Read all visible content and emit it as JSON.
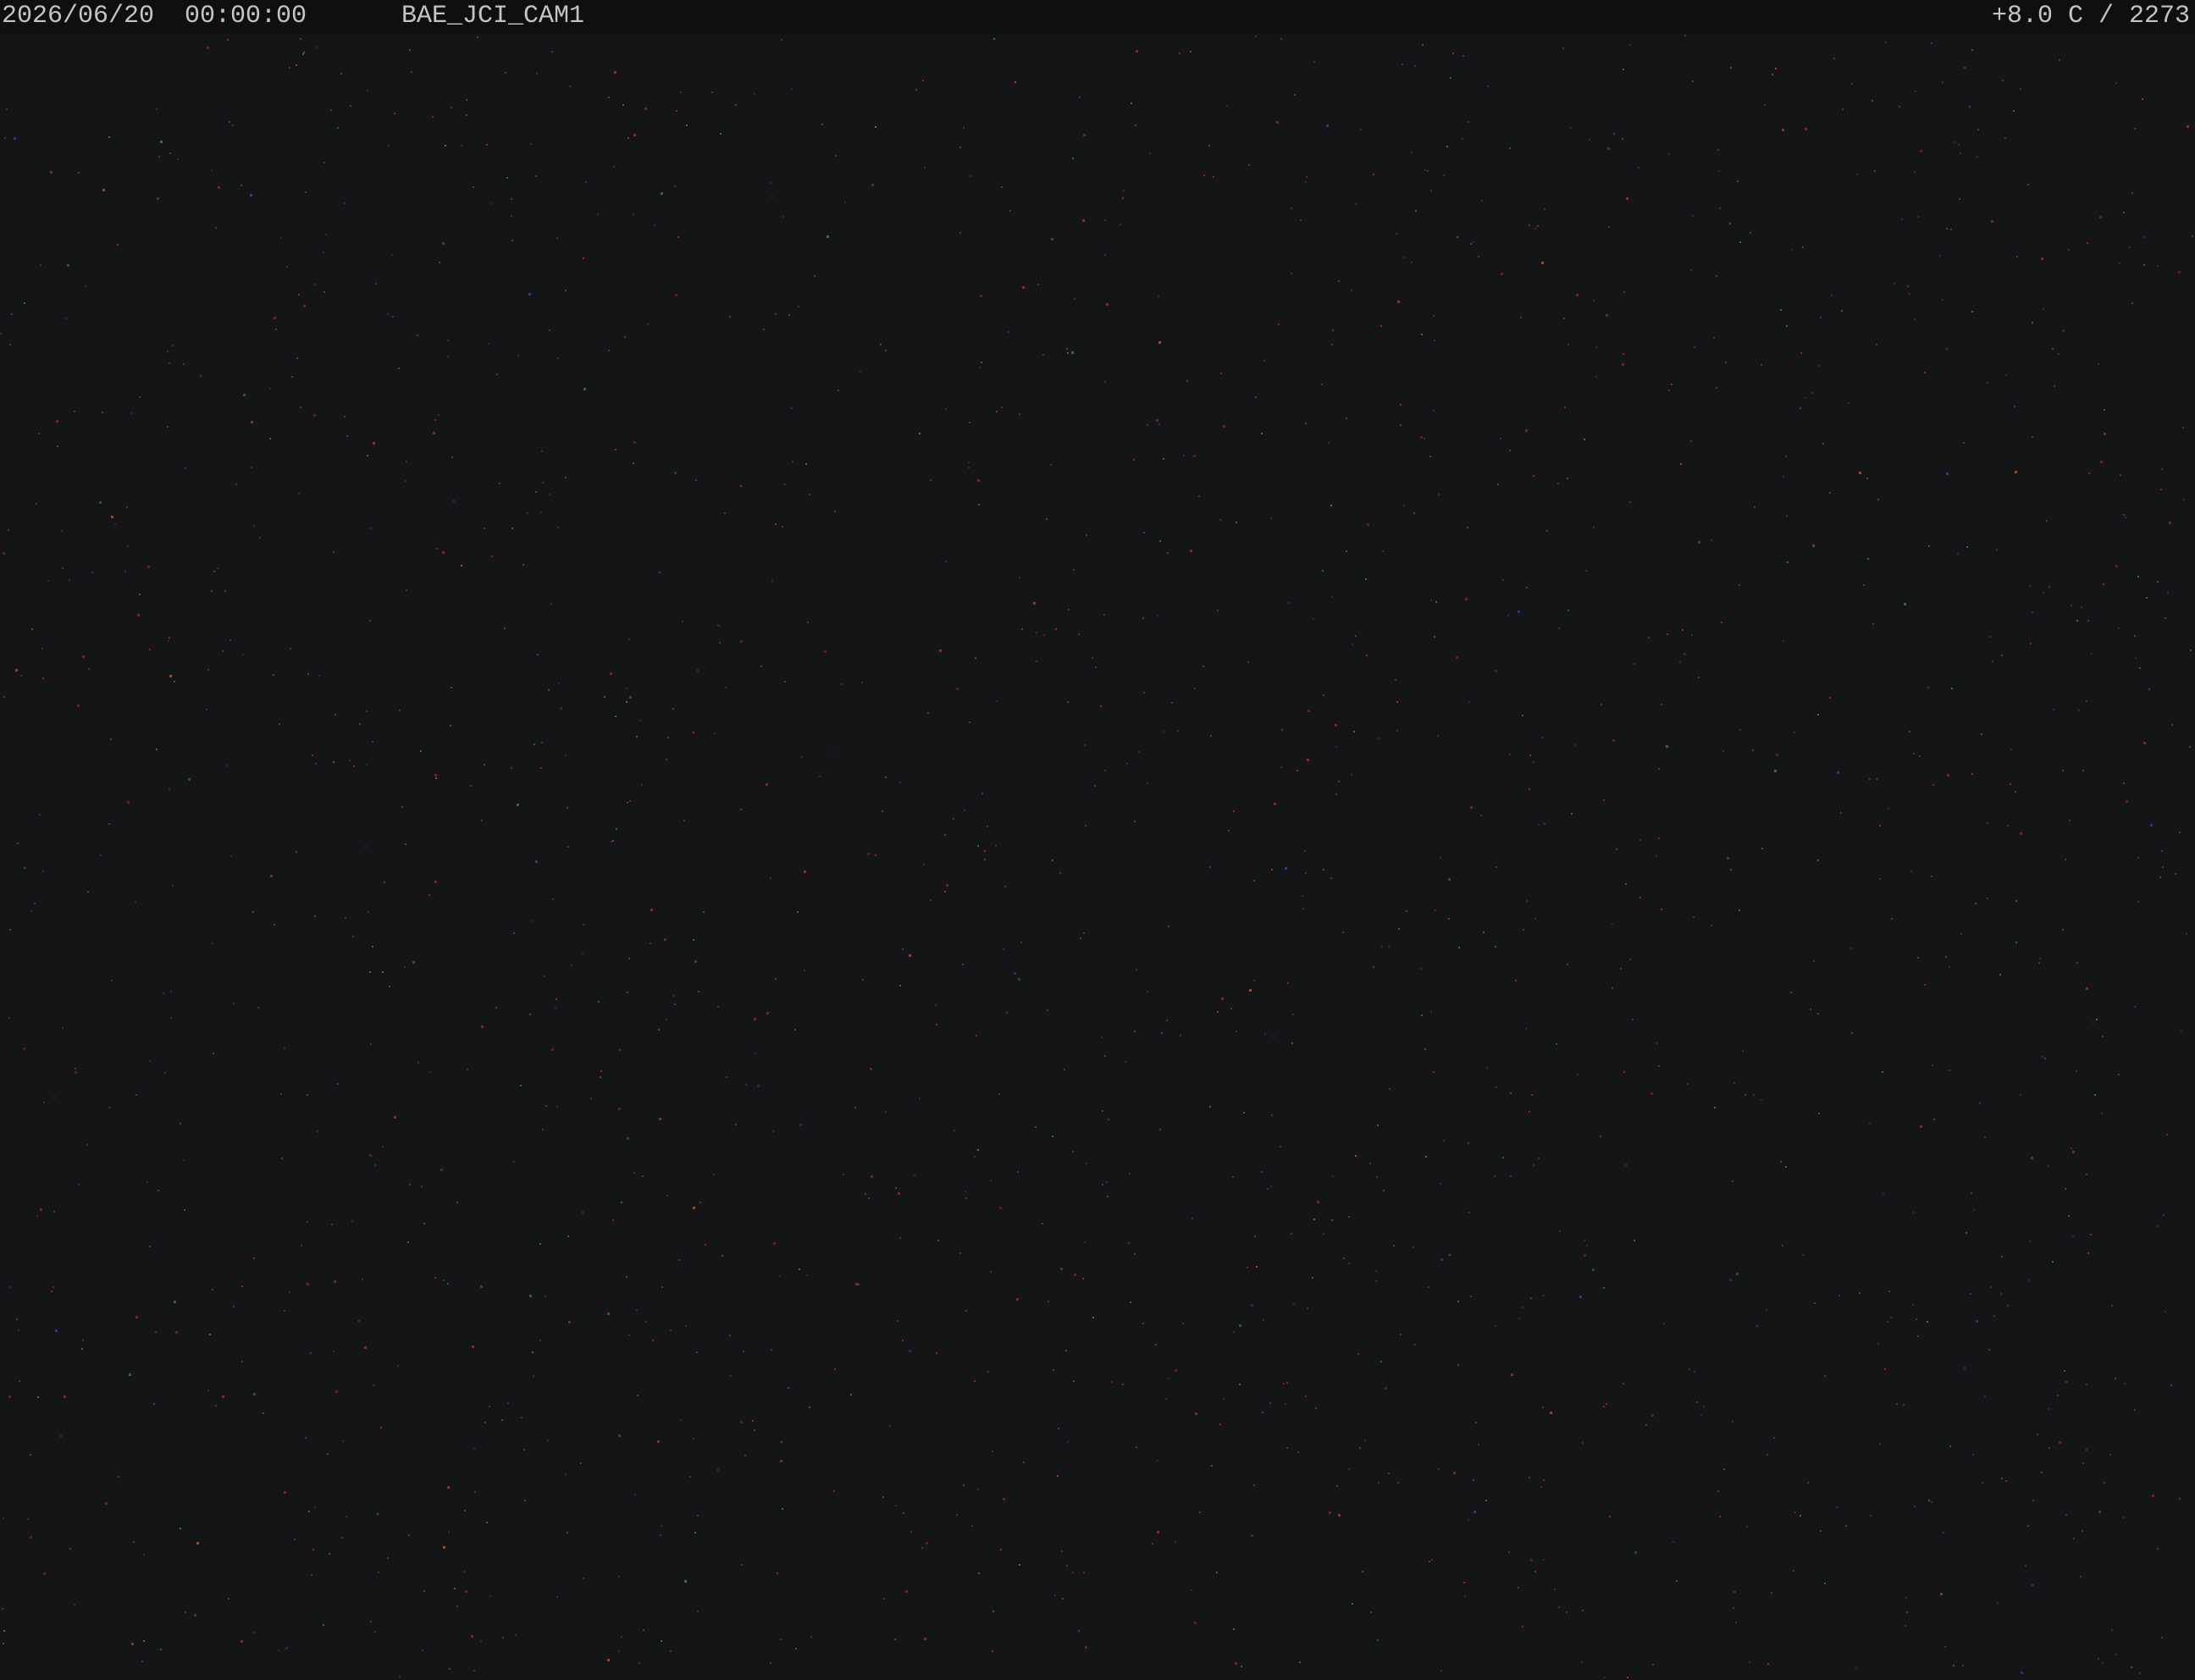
{
  "overlay": {
    "datetime": "2026/06/20  00:00:00",
    "camera_id": "BAE_JCI_CAM1",
    "readout": "+8.0 C / 2273"
  },
  "scene": {
    "description_kind": "night sky camera frame",
    "background_color": "#141516",
    "noise_colors": [
      "#a8233a",
      "#3b7a4a",
      "#3a3fa8",
      "#b84a2a"
    ]
  }
}
